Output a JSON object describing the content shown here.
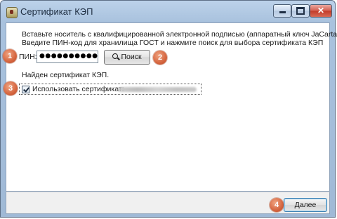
{
  "window": {
    "title": "Сертификат КЭП"
  },
  "instructions": {
    "line1": "Вставьте носитель с квалифицированной электронной подписью (аппаратный ключ JaCarta)",
    "line2": "Введите ПИН-код для хранилища ГОСТ и нажмите поиск для выбора сертификата КЭП"
  },
  "pin": {
    "label": "ПИН:",
    "value": "●●●●●●●●●●"
  },
  "search_button": {
    "label": "Поиск"
  },
  "status": {
    "found_text": "Найден сертификат КЭП."
  },
  "certificate": {
    "checkbox_label": "Использовать сертификат:",
    "checked": true
  },
  "next_button": {
    "label": "Далее"
  },
  "badges": [
    "1",
    "2",
    "3",
    "4"
  ],
  "colors": {
    "badge": "#d5653f",
    "titlebar": "#bcd2ea",
    "close": "#c23a28"
  }
}
